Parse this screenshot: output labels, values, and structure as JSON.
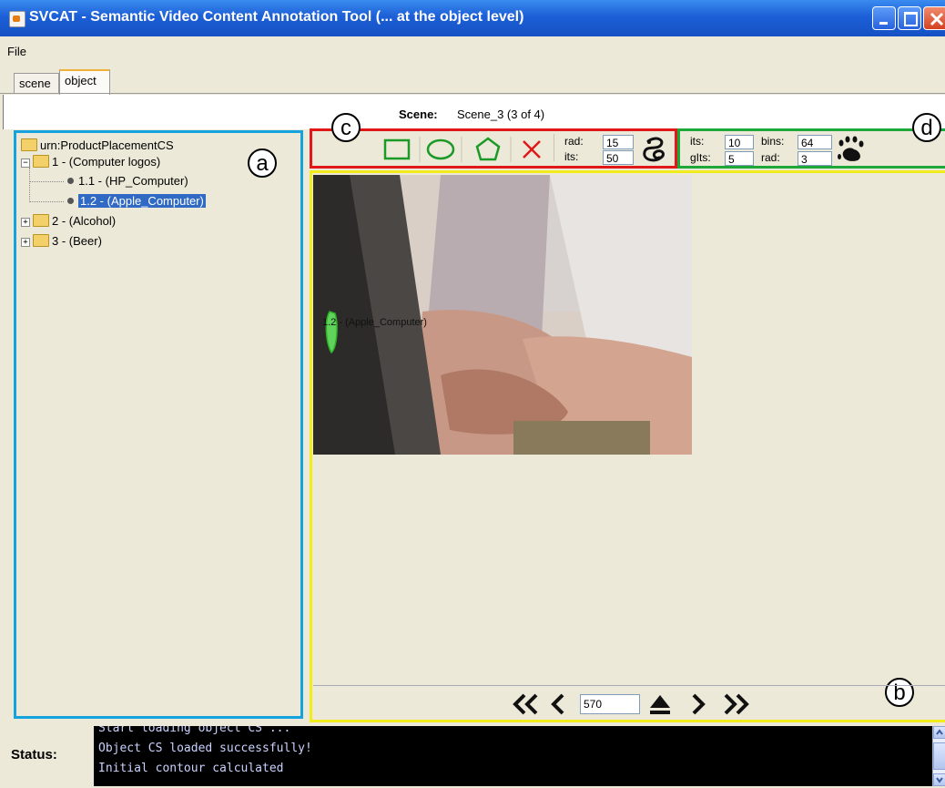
{
  "window": {
    "title": "SVCAT - Semantic Video Content Annotation Tool (... at the object level)"
  },
  "menu": {
    "file": "File"
  },
  "tabs": [
    {
      "label": "scene",
      "active": false
    },
    {
      "label": "object",
      "active": true
    }
  ],
  "scene_bar": {
    "label": "Scene:",
    "value": "Scene_3 (3 of 4)"
  },
  "tree": {
    "root": "urn:ProductPlacementCS",
    "nodes": [
      {
        "label": "1 - (Computer logos)",
        "expanded": true
      },
      {
        "label": "1.1 - (HP_Computer)",
        "selected": false
      },
      {
        "label": "1.2 - (Apple_Computer)",
        "selected": true
      },
      {
        "label": "2 - (Alcohol)",
        "expanded": false
      },
      {
        "label": "3 - (Beer)",
        "expanded": false
      }
    ]
  },
  "annotations": {
    "a": "a",
    "b": "b",
    "c": "c",
    "d": "d"
  },
  "shape_tools": {
    "rad_label": "rad:",
    "rad_value": "15",
    "its_label": "its:",
    "its_value": "50",
    "icons": [
      "rectangle-icon",
      "ellipse-icon",
      "polygon-icon",
      "delete-icon",
      "snake-icon"
    ]
  },
  "grabcut_tools": {
    "its_label": "its:",
    "its_value": "10",
    "bins_label": "bins:",
    "bins_value": "64",
    "glts_label": "gIts:",
    "glts_value": "5",
    "rad_label": "rad:",
    "rad_value": "3",
    "icon": "paw-icon"
  },
  "video": {
    "object_label": "1.2 - (Apple_Computer)"
  },
  "navigation": {
    "frame": "570",
    "icons": [
      "first-icon",
      "prev-icon",
      "eject-icon",
      "next-icon",
      "last-icon"
    ]
  },
  "status": {
    "label": "Status:",
    "lines": [
      "Start loading object CS ...",
      "Object CS loaded successfully!",
      "Initial contour calculated"
    ]
  },
  "colors": {
    "annotation_a": "#15a3e0",
    "annotation_c": "#e01818",
    "annotation_d": "#1ea83a",
    "annotation_b": "#f2ec1c",
    "shape_tool_green": "#1c9a28",
    "delete_red": "#e01818",
    "selection": "#316ac5"
  }
}
